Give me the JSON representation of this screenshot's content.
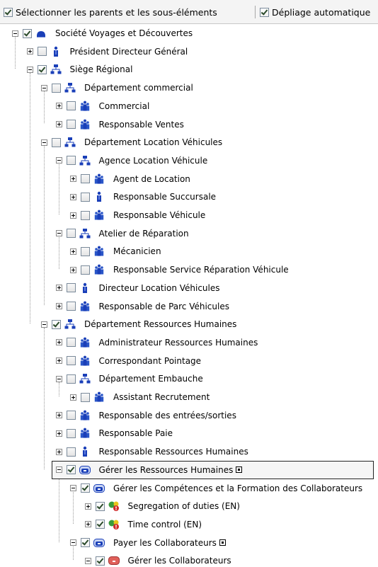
{
  "toolbar": {
    "select_parents_label": "Sélectionner les parents et les sous-éléments",
    "auto_expand_label": "Dépliage automatique",
    "select_parents_checked": true,
    "auto_expand_checked": true
  },
  "colors": {
    "icon_blue": "#1a3fb8",
    "role_blue": "#2a56c8",
    "process_red": "#e0605a",
    "status_green": "#3a9a3a",
    "status_yellow": "#e8c41a",
    "status_red": "#d02a2a"
  },
  "tree": [
    {
      "label": "Société Voyages et Découvertes",
      "level": 0,
      "expander": "minus",
      "checked": true,
      "icon": "company-icon",
      "popup": false
    },
    {
      "label": "Président Directeur Général",
      "level": 1,
      "expander": "plus",
      "checked": false,
      "icon": "person-icon",
      "popup": false
    },
    {
      "label": "Siège Régional",
      "level": 1,
      "expander": "minus",
      "checked": true,
      "icon": "org-chart-icon",
      "popup": false
    },
    {
      "label": "Département commercial",
      "level": 2,
      "expander": "minus",
      "checked": false,
      "icon": "org-chart-icon",
      "popup": false
    },
    {
      "label": "Commercial",
      "level": 3,
      "expander": "plus",
      "checked": false,
      "icon": "group-icon",
      "popup": false
    },
    {
      "label": "Responsable Ventes",
      "level": 3,
      "expander": "plus",
      "checked": false,
      "icon": "group-icon",
      "popup": false
    },
    {
      "label": "Département Location Véhicules",
      "level": 2,
      "expander": "minus",
      "checked": false,
      "icon": "org-chart-icon",
      "popup": false
    },
    {
      "label": "Agence Location Véhicule",
      "level": 3,
      "expander": "minus",
      "checked": false,
      "icon": "org-chart-icon",
      "popup": false
    },
    {
      "label": "Agent de Location",
      "level": 4,
      "expander": "plus",
      "checked": false,
      "icon": "group-icon",
      "popup": false
    },
    {
      "label": "Responsable Succursale",
      "level": 4,
      "expander": "plus",
      "checked": false,
      "icon": "person-icon",
      "popup": false
    },
    {
      "label": "Responsable Véhicule",
      "level": 4,
      "expander": "plus",
      "checked": false,
      "icon": "group-icon",
      "popup": false
    },
    {
      "label": "Atelier de Réparation",
      "level": 3,
      "expander": "minus",
      "checked": false,
      "icon": "org-chart-icon",
      "popup": false
    },
    {
      "label": "Mécanicien",
      "level": 4,
      "expander": "plus",
      "checked": false,
      "icon": "group-icon",
      "popup": false
    },
    {
      "label": "Responsable Service Réparation Véhicule",
      "level": 4,
      "expander": "plus",
      "checked": false,
      "icon": "group-icon",
      "popup": false
    },
    {
      "label": "Directeur Location Véhicules",
      "level": 3,
      "expander": "plus",
      "checked": false,
      "icon": "person-icon",
      "popup": false
    },
    {
      "label": "Responsable de Parc Véhicules",
      "level": 3,
      "expander": "plus",
      "checked": false,
      "icon": "group-icon",
      "popup": false
    },
    {
      "label": "Département Ressources Humaines",
      "level": 2,
      "expander": "minus",
      "checked": true,
      "icon": "org-chart-icon",
      "popup": false
    },
    {
      "label": "Administrateur Ressources Humaines",
      "level": 3,
      "expander": "plus",
      "checked": false,
      "icon": "group-icon",
      "popup": false
    },
    {
      "label": "Correspondant Pointage",
      "level": 3,
      "expander": "plus",
      "checked": false,
      "icon": "group-icon",
      "popup": false
    },
    {
      "label": "Département Embauche",
      "level": 3,
      "expander": "minus",
      "checked": false,
      "icon": "org-chart-icon",
      "popup": false
    },
    {
      "label": "Assistant Recrutement",
      "level": 4,
      "expander": "plus",
      "checked": false,
      "icon": "group-icon",
      "popup": false
    },
    {
      "label": "Responsable des entrées/sorties",
      "level": 3,
      "expander": "plus",
      "checked": false,
      "icon": "group-icon",
      "popup": false
    },
    {
      "label": "Responsable Paie",
      "level": 3,
      "expander": "plus",
      "checked": false,
      "icon": "group-icon",
      "popup": false
    },
    {
      "label": "Responsable Ressources Humaines",
      "level": 3,
      "expander": "plus",
      "checked": false,
      "icon": "person-icon",
      "popup": false
    },
    {
      "label": "Gérer les Ressources Humaines",
      "level": 3,
      "expander": "minus",
      "checked": true,
      "icon": "process-icon",
      "popup": true,
      "selected": true
    },
    {
      "label": "Gérer les Compétences et la Formation des Collaborateurs",
      "level": 4,
      "expander": "minus",
      "checked": true,
      "icon": "process-icon",
      "popup": false
    },
    {
      "label": "Segregation of duties (EN)",
      "level": 5,
      "expander": "plus",
      "checked": true,
      "icon": "risk-control-icon",
      "popup": false
    },
    {
      "label": "Time control (EN)",
      "level": 5,
      "expander": "plus",
      "checked": true,
      "icon": "risk-control-icon",
      "popup": false
    },
    {
      "label": "Payer les Collaborateurs",
      "level": 4,
      "expander": "minus",
      "checked": true,
      "icon": "process-icon",
      "popup": true
    },
    {
      "label": "Gérer les Collaborateurs",
      "level": 5,
      "expander": "minus",
      "checked": true,
      "icon": "process-red-icon",
      "popup": false
    }
  ]
}
